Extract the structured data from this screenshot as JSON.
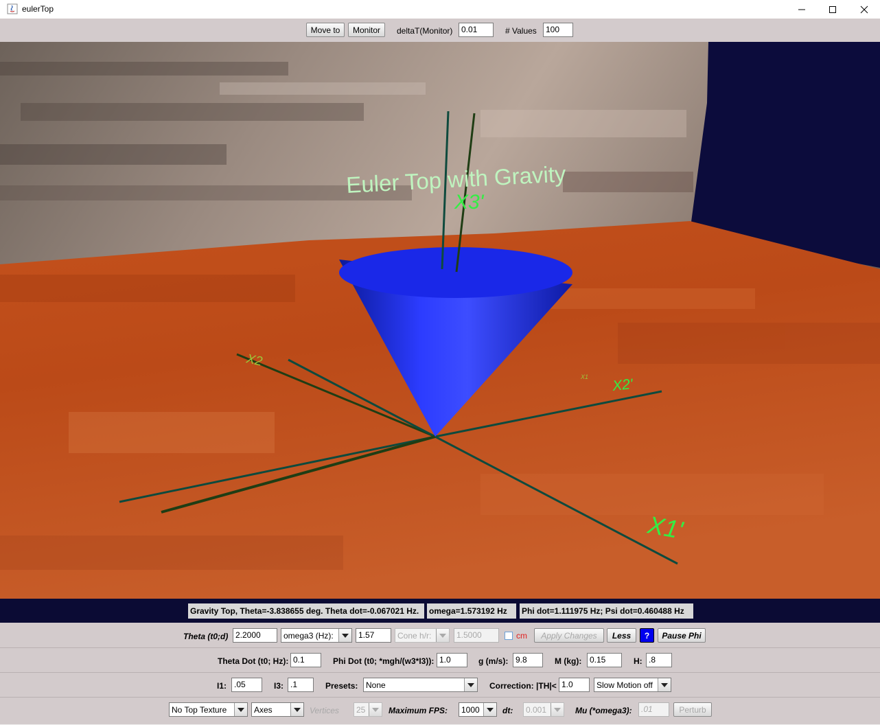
{
  "window": {
    "title": "eulerTop"
  },
  "toolbar": {
    "move_to_label": "Move to",
    "monitor_label": "Monitor",
    "delta_label": "deltaT(Monitor)",
    "delta_value": "0.01",
    "values_label": "# Values",
    "values_value": "100"
  },
  "scene": {
    "title": "Euler Top with Gravity",
    "axis_labels": {
      "x3p": "X3'",
      "x2": "X2",
      "x2p": "X2'",
      "x1p": "X1'",
      "x1": "X1"
    }
  },
  "status": {
    "gravity": "Gravity Top, Theta=-3.838655 deg. Theta dot=-0.067021 Hz.",
    "omega": "omega=1.573192 Hz",
    "phi": "Phi dot=1.111975 Hz;  Psi dot=0.460488 Hz"
  },
  "controls": {
    "row1": {
      "theta_label": "Theta (t0;d)",
      "theta_value": "2.2000",
      "omega3_select": "omega3 (Hz):",
      "omega3_value": "1.57",
      "cone_select": "Cone h/r:",
      "cone_value": "1.5000",
      "cm_label": "cm",
      "apply_label": "Apply Changes",
      "less_label": "Less",
      "help_label": "?",
      "pause_label": "Pause Phi"
    },
    "row2": {
      "theta_dot_label": "Theta Dot (t0; Hz):",
      "theta_dot_value": "0.1",
      "phi_dot_label": "Phi Dot (t0; *mgh/(w3*I3)):",
      "phi_dot_value": "1.0",
      "g_label": "g (m/s):",
      "g_value": "9.8",
      "m_label": "M (kg):",
      "m_value": "0.15",
      "h_label": "H:",
      "h_value": ".8"
    },
    "row3": {
      "i1_label": "I1:",
      "i1_value": ".05",
      "i3_label": "I3:",
      "i3_value": ".1",
      "presets_label": "Presets:",
      "presets_value": "None",
      "correction_label": "Correction: |TH|<",
      "correction_value": "1.0",
      "slowmotion_value": "Slow Motion off"
    },
    "row4": {
      "texture_value": "No Top Texture",
      "axes_value": "Axes",
      "vertices_label": "Vertices",
      "vertices_value": "25",
      "fps_label": "Maximum FPS:",
      "fps_value": "1000",
      "dt_label": "dt:",
      "dt_value": "0.001",
      "mu_label": "Mu (*omega3):",
      "mu_value": ".01",
      "perturb_label": "Perturb"
    }
  },
  "colors": {
    "status_bg": "#0b0b34",
    "cone": "#1a2be0",
    "axis_label": "#33ee44",
    "floor": "#c14a18"
  }
}
